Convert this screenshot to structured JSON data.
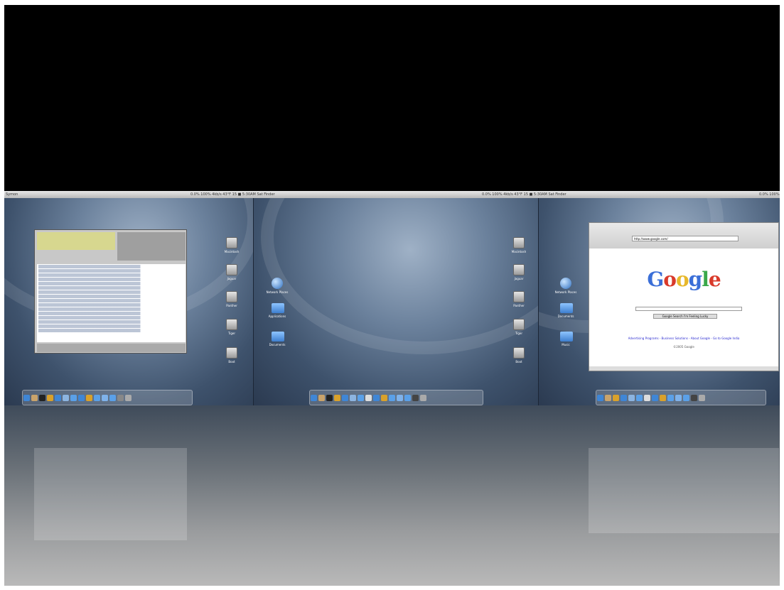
{
  "menubar": {
    "left": "Symon",
    "mid_status": "0.0% 100% 4kb/s 43°F 15 ■ 5:30AM Sat  Finder",
    "right_status": "0.0% 100% 4kb/s 43°F 15 ■ 5:30AM Sat  Finder",
    "far_right": "0.0% 100%"
  },
  "screen1": {
    "drives": [
      "Macintosh",
      "Jaguar",
      "Panther",
      "Tiger",
      "Boot"
    ]
  },
  "screen2": {
    "desktop_items": [
      "Network Places",
      "Applications",
      "Documents"
    ],
    "drives": [
      "Macintosh",
      "Jaguar",
      "Panther",
      "Tiger",
      "Boot"
    ]
  },
  "screen3": {
    "desktop_items": [
      "Network Places",
      "Documents",
      "Music"
    ],
    "browser": {
      "address": "http://www.google.com/",
      "logo": "Google",
      "button": "Google Search   I'm Feeling Lucky",
      "links": "Advertising Programs - Business Solutions - About Google - Go to Google India",
      "copyright": "©2005 Google"
    }
  },
  "colors": {
    "desktop": "#5a708c",
    "menubar": "#d0d0d0",
    "dock_icon_blue": "#3f86d6"
  }
}
